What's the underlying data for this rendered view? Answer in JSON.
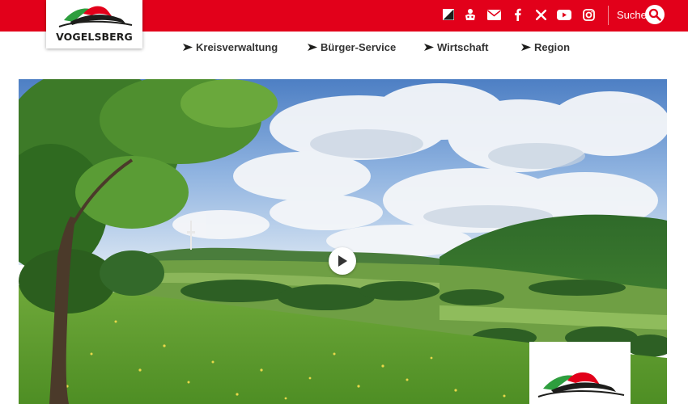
{
  "header": {
    "logo_text": "VOGELSBERG",
    "social_icons": [
      {
        "name": "contrast-icon"
      },
      {
        "name": "sign-language-icon"
      },
      {
        "name": "email-icon"
      },
      {
        "name": "facebook-icon"
      },
      {
        "name": "x-icon"
      },
      {
        "name": "youtube-icon"
      },
      {
        "name": "instagram-icon"
      }
    ],
    "search_label": "Suche",
    "colors": {
      "brand_red": "#e2001a",
      "logo_green": "#2e9e3e",
      "logo_red": "#e2001a"
    }
  },
  "nav": {
    "items": [
      {
        "label": "Kreisverwaltung"
      },
      {
        "label": "Bürger-Service"
      },
      {
        "label": "Wirtschaft"
      },
      {
        "label": "Region"
      }
    ]
  },
  "hero": {
    "play_icon": "play-icon",
    "description_icon": "landscape-photo"
  }
}
